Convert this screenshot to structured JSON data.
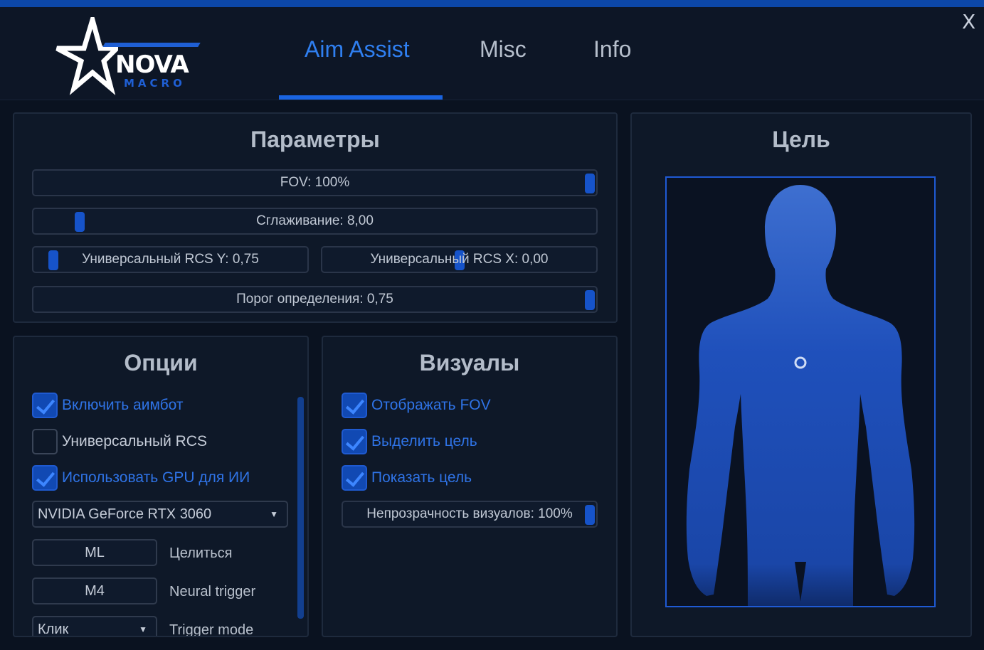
{
  "header": {
    "logo": {
      "word": "NOVA",
      "sub": "MACRO"
    },
    "tabs": [
      {
        "label": "Aim Assist",
        "active": true
      },
      {
        "label": "Misc",
        "active": false
      },
      {
        "label": "Info",
        "active": false
      }
    ],
    "close_label": "X"
  },
  "params": {
    "title": "Параметры",
    "sliders": {
      "fov": {
        "label": "FOV: 100%",
        "value": 1.0
      },
      "smoothing": {
        "label": "Сглаживание: 8,00",
        "value": 0.08
      },
      "rcs_y": {
        "label": "Универсальный RCS Y: 0,75",
        "value": 0.08
      },
      "rcs_x": {
        "label": "Универсальный RCS X: 0,00",
        "value": 0.5
      },
      "threshold": {
        "label": "Порог определения: 0,75",
        "value": 1.0
      }
    }
  },
  "options": {
    "title": "Опции",
    "checks": [
      {
        "label": "Включить аимбот",
        "checked": true
      },
      {
        "label": "Универсальный RCS",
        "checked": false
      },
      {
        "label": "Использовать GPU для ИИ",
        "checked": true
      }
    ],
    "gpu_select": "NVIDIA GeForce RTX 3060",
    "aim_key": {
      "key": "ML",
      "label": "Целиться"
    },
    "trigger_key": {
      "key": "M4",
      "label": "Neural trigger"
    },
    "trigger_mode": {
      "value": "Клик",
      "label": "Trigger mode"
    }
  },
  "visuals": {
    "title": "Визуалы",
    "checks": [
      {
        "label": "Отображать FOV",
        "checked": true
      },
      {
        "label": "Выделить цель",
        "checked": true
      },
      {
        "label": "Показать цель",
        "checked": true
      }
    ],
    "opacity": {
      "label": "Непрозрачность визуалов: 100%",
      "value": 1.0
    }
  },
  "target": {
    "title": "Цель"
  },
  "colors": {
    "accent": "#1a64e0",
    "accent_text": "#2f7ff0",
    "background": "#0a1220",
    "panel": "#0e1828",
    "body_silhouette": "#1c4bb3"
  }
}
